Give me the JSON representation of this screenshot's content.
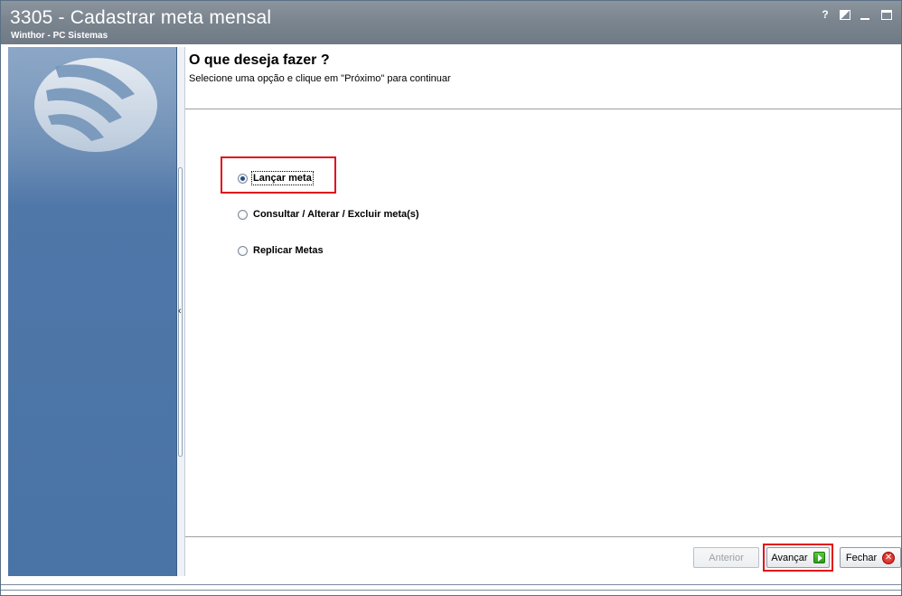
{
  "window": {
    "title": "3305 - Cadastrar meta mensal",
    "subtitle": "Winthor - PC Sistemas",
    "controls": {
      "help": "?",
      "restore": "restore",
      "minimize": "minimize",
      "maximize": "maximize"
    }
  },
  "content": {
    "heading": "O que deseja fazer ?",
    "subheading": "Selecione uma opção e clique em \"Próximo\" para continuar",
    "options": [
      {
        "label": "Lançar meta",
        "checked": true
      },
      {
        "label": "Consultar / Alterar / Excluir meta(s)",
        "checked": false
      },
      {
        "label": "Replicar Metas",
        "checked": false
      }
    ]
  },
  "footer": {
    "back_label": "Anterior",
    "next_label": "Avançar",
    "close_label": "Fechar"
  },
  "icons": {
    "logo": "pc-sistemas-logo-icon",
    "next": "arrow-right-icon",
    "close": "close-icon",
    "splitter": "chevron-left-icon"
  },
  "colors": {
    "titlebar": "#7b858f",
    "left_panel": "#4a74a6",
    "highlight": "#e0101a"
  }
}
